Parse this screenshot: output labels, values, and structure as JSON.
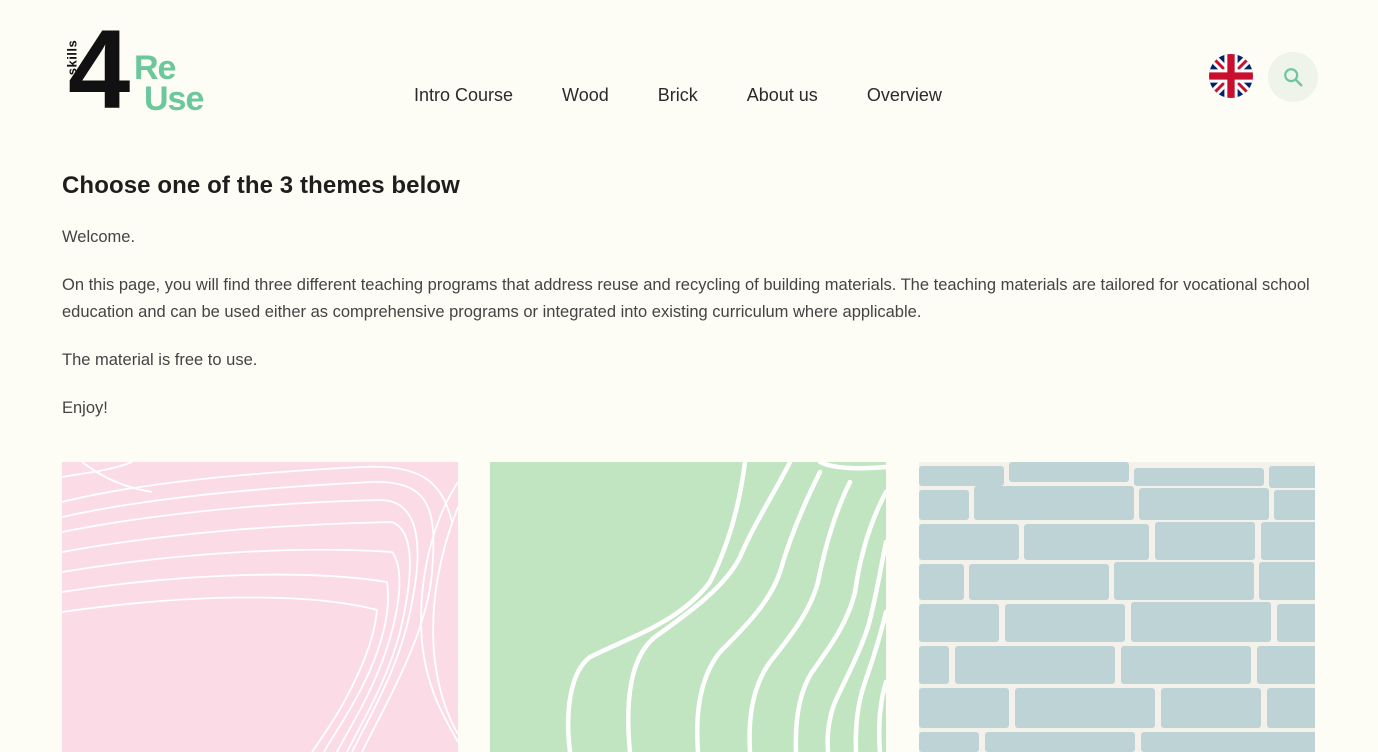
{
  "header": {
    "logo": {
      "skills": "skills",
      "four": "4",
      "re": "Re",
      "use": "Use"
    },
    "nav": [
      {
        "label": "Intro Course"
      },
      {
        "label": "Wood"
      },
      {
        "label": "Brick"
      },
      {
        "label": "About us"
      },
      {
        "label": "Overview"
      }
    ],
    "language_icon": "uk-flag-icon",
    "search_icon": "search-icon"
  },
  "main": {
    "title": "Choose one of the 3 themes below",
    "paragraphs": [
      "Welcome.",
      "On this page, you will find three different teaching programs that address reuse and recycling of building materials. The teaching materials are tailored for vocational school education and can be used either as comprehensive programs or integrated into existing curriculum where applicable.",
      "The material is free to use.",
      "Enjoy!"
    ]
  },
  "cards": [
    {
      "theme": "intro",
      "color": "#fbdbe6"
    },
    {
      "theme": "wood",
      "color": "#c1e5c0"
    },
    {
      "theme": "brick",
      "color": "#bed3d6"
    }
  ],
  "colors": {
    "background": "#fdfcf5",
    "accent": "#6cc79b",
    "search_bg": "#eef4e9"
  }
}
